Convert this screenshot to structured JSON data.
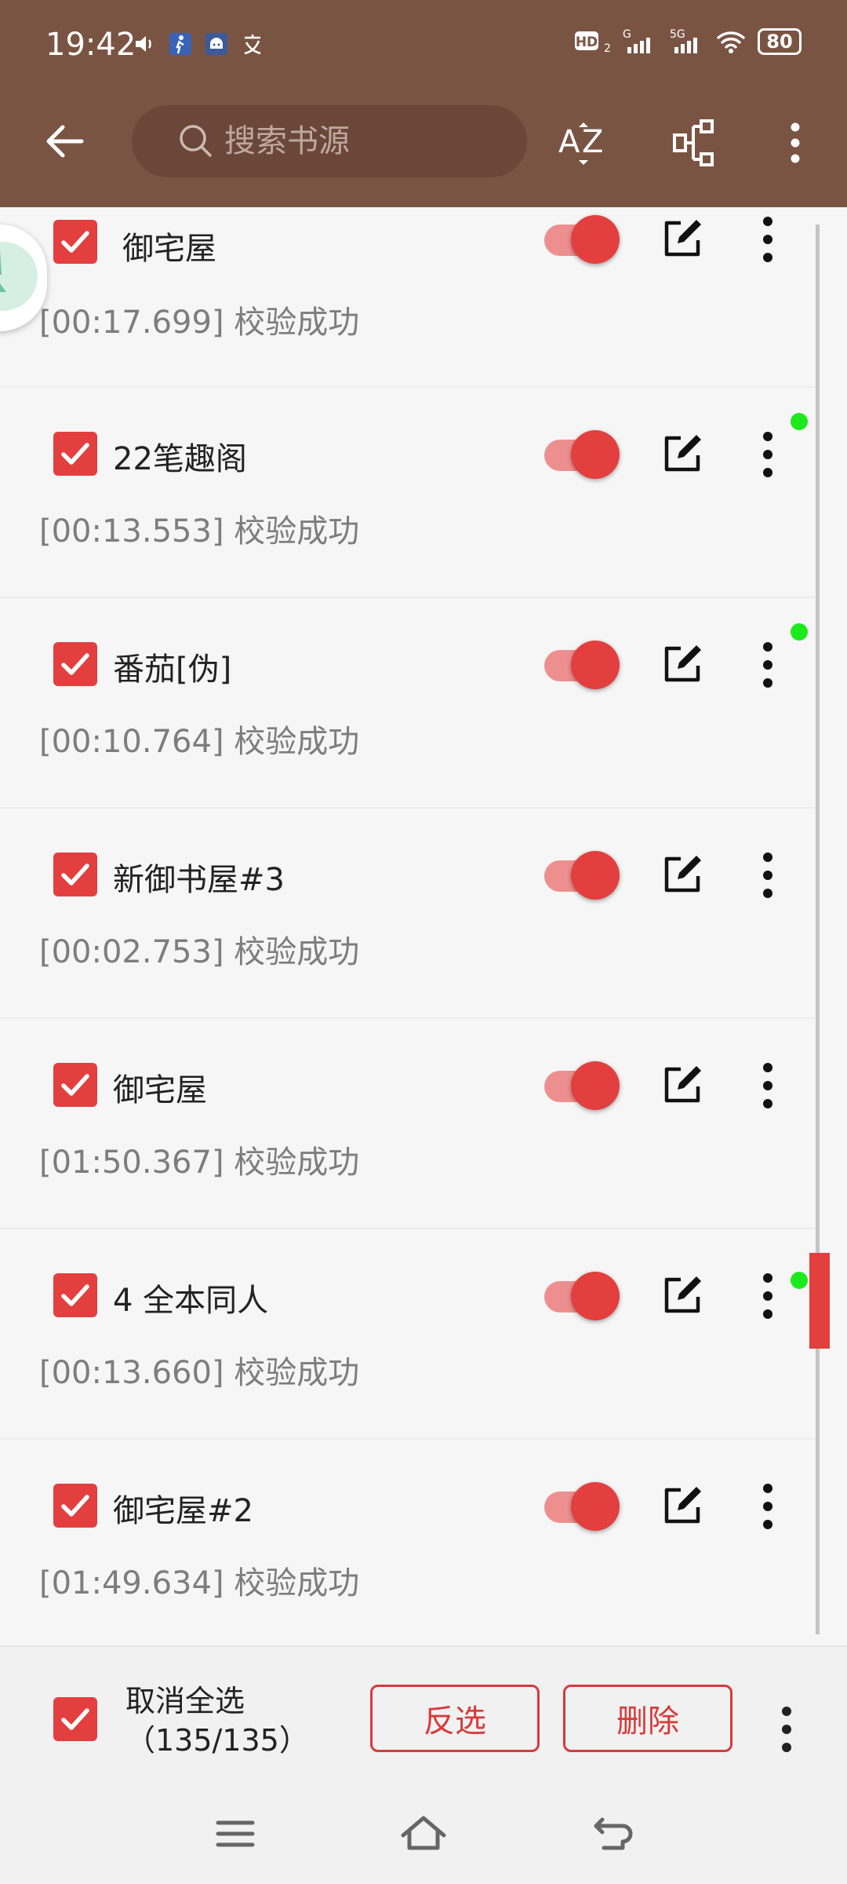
{
  "status_bar": {
    "time": "19:42",
    "hd_label": "HD",
    "signal_labels": [
      "G",
      "5G"
    ],
    "battery": "80"
  },
  "toolbar": {
    "search_placeholder": "搜索书源",
    "sort_icon": "az-sort-icon",
    "group_icon": "group-icon",
    "more_icon": "more-vert-icon"
  },
  "colors": {
    "app_bar": "#7a5443",
    "accent": "#e33f3f",
    "accent_light": "#ee8f8f",
    "status_dot": "#1dea1d"
  },
  "sources": [
    {
      "name": "御宅屋",
      "status": "[00:17.699] 校验成功",
      "enabled": true,
      "checked": true,
      "has_dot": false
    },
    {
      "name": "22笔趣阁",
      "status": "[00:13.553] 校验成功",
      "enabled": true,
      "checked": true,
      "has_dot": true
    },
    {
      "name": "番茄[伪]",
      "status": "[00:10.764] 校验成功",
      "enabled": true,
      "checked": true,
      "has_dot": true
    },
    {
      "name": "新御书屋#3",
      "status": "[00:02.753] 校验成功",
      "enabled": true,
      "checked": true,
      "has_dot": false
    },
    {
      "name": "御宅屋",
      "status": "[01:50.367] 校验成功",
      "enabled": true,
      "checked": true,
      "has_dot": false
    },
    {
      "name": "4 全本同人",
      "status": "[00:13.660] 校验成功",
      "enabled": true,
      "checked": true,
      "has_dot": true
    },
    {
      "name": "御宅屋#2",
      "status": "[01:49.634] 校验成功",
      "enabled": true,
      "checked": true,
      "has_dot": false
    }
  ],
  "bottom_bar": {
    "select_label": "取消全选",
    "count": "（135/135）",
    "invert_label": "反选",
    "delete_label": "删除"
  },
  "nav": [
    "menu-icon",
    "home-icon",
    "back-icon"
  ]
}
